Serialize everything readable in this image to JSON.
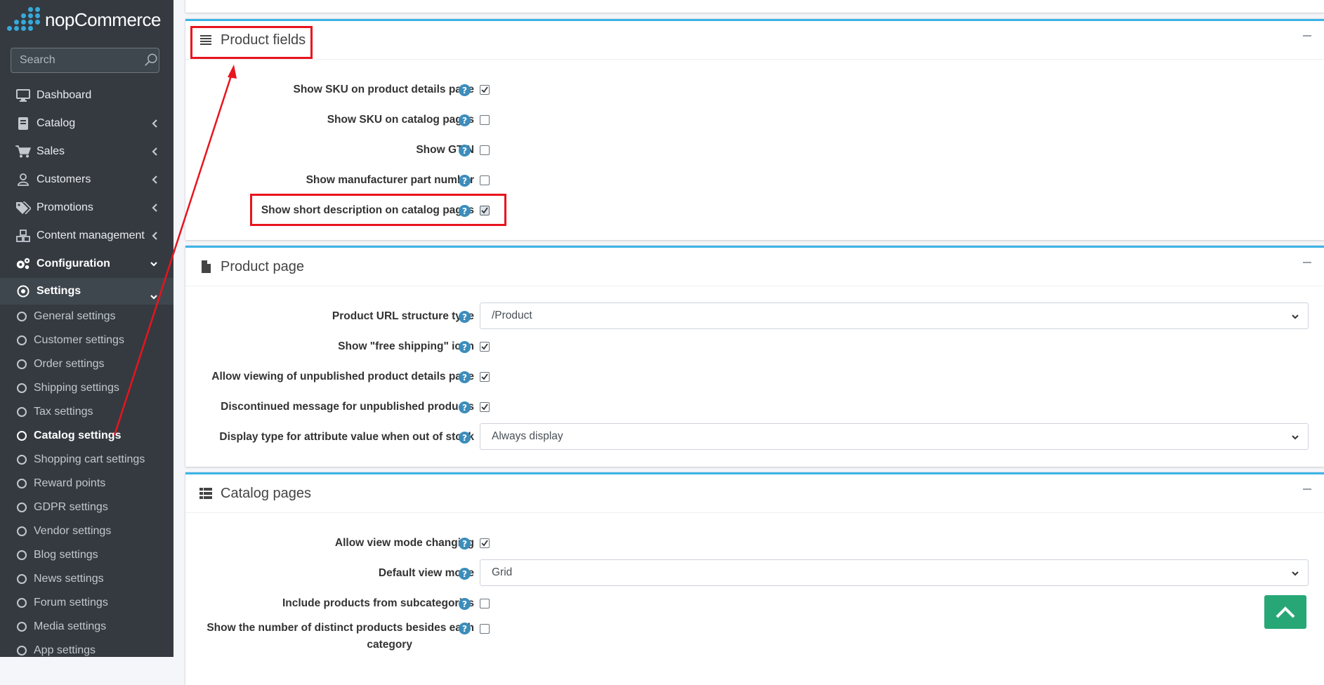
{
  "brand": {
    "name_light": "nop",
    "name_bold": "Commerce"
  },
  "search": {
    "placeholder": "Search"
  },
  "nav": [
    {
      "label": "Dashboard",
      "icon": "monitor-icon"
    },
    {
      "label": "Catalog",
      "icon": "book-icon"
    },
    {
      "label": "Sales",
      "icon": "cart-icon"
    },
    {
      "label": "Customers",
      "icon": "user-icon"
    },
    {
      "label": "Promotions",
      "icon": "tags-icon"
    },
    {
      "label": "Content management",
      "icon": "cubes-icon"
    },
    {
      "label": "Configuration",
      "icon": "gears-icon"
    },
    {
      "label": "Settings",
      "icon": "dot-circle-icon"
    }
  ],
  "settings_items": [
    "General settings",
    "Customer settings",
    "Order settings",
    "Shipping settings",
    "Tax settings",
    "Catalog settings",
    "Shopping cart settings",
    "Reward points",
    "GDPR settings",
    "Vendor settings",
    "Blog settings",
    "News settings",
    "Forum settings",
    "Media settings",
    "App settings"
  ],
  "current_settings_item": "Catalog settings",
  "product_fields": {
    "title": "Product fields",
    "rows": [
      {
        "label": "Show SKU on product details page",
        "checked": true
      },
      {
        "label": "Show SKU on catalog pages",
        "checked": false
      },
      {
        "label": "Show GTIN",
        "checked": false
      },
      {
        "label": "Show manufacturer part number",
        "checked": false
      },
      {
        "label": "Show short description on catalog pages",
        "checked": true
      }
    ]
  },
  "product_page": {
    "title": "Product page",
    "url_structure": {
      "label": "Product URL structure type",
      "value": "/Product"
    },
    "free_shipping": {
      "label": "Show \"free shipping\" icon",
      "checked": true
    },
    "allow_unpublished": {
      "label": "Allow viewing of unpublished product details page",
      "checked": true
    },
    "discontinued": {
      "label": "Discontinued message for unpublished products",
      "checked": true
    },
    "out_of_stock": {
      "label": "Display type for attribute value when out of stock",
      "value": "Always display"
    }
  },
  "catalog_pages": {
    "title": "Catalog pages",
    "view_mode_changing": {
      "label": "Allow view mode changing",
      "checked": true
    },
    "default_view_mode": {
      "label": "Default view mode",
      "value": "Grid"
    },
    "include_subcategories": {
      "label": "Include products from subcategories",
      "checked": false
    },
    "distinct_products": {
      "label_line1": "Show the number of distinct products besides each",
      "label_line2": "category",
      "checked": false
    }
  },
  "help_glyph": "?",
  "colors": {
    "sidebar": "#343a40",
    "accent": "#3cb3e6",
    "help": "#3c8dbc",
    "annotation": "#e8141e",
    "scroll_top": "#28a776"
  }
}
